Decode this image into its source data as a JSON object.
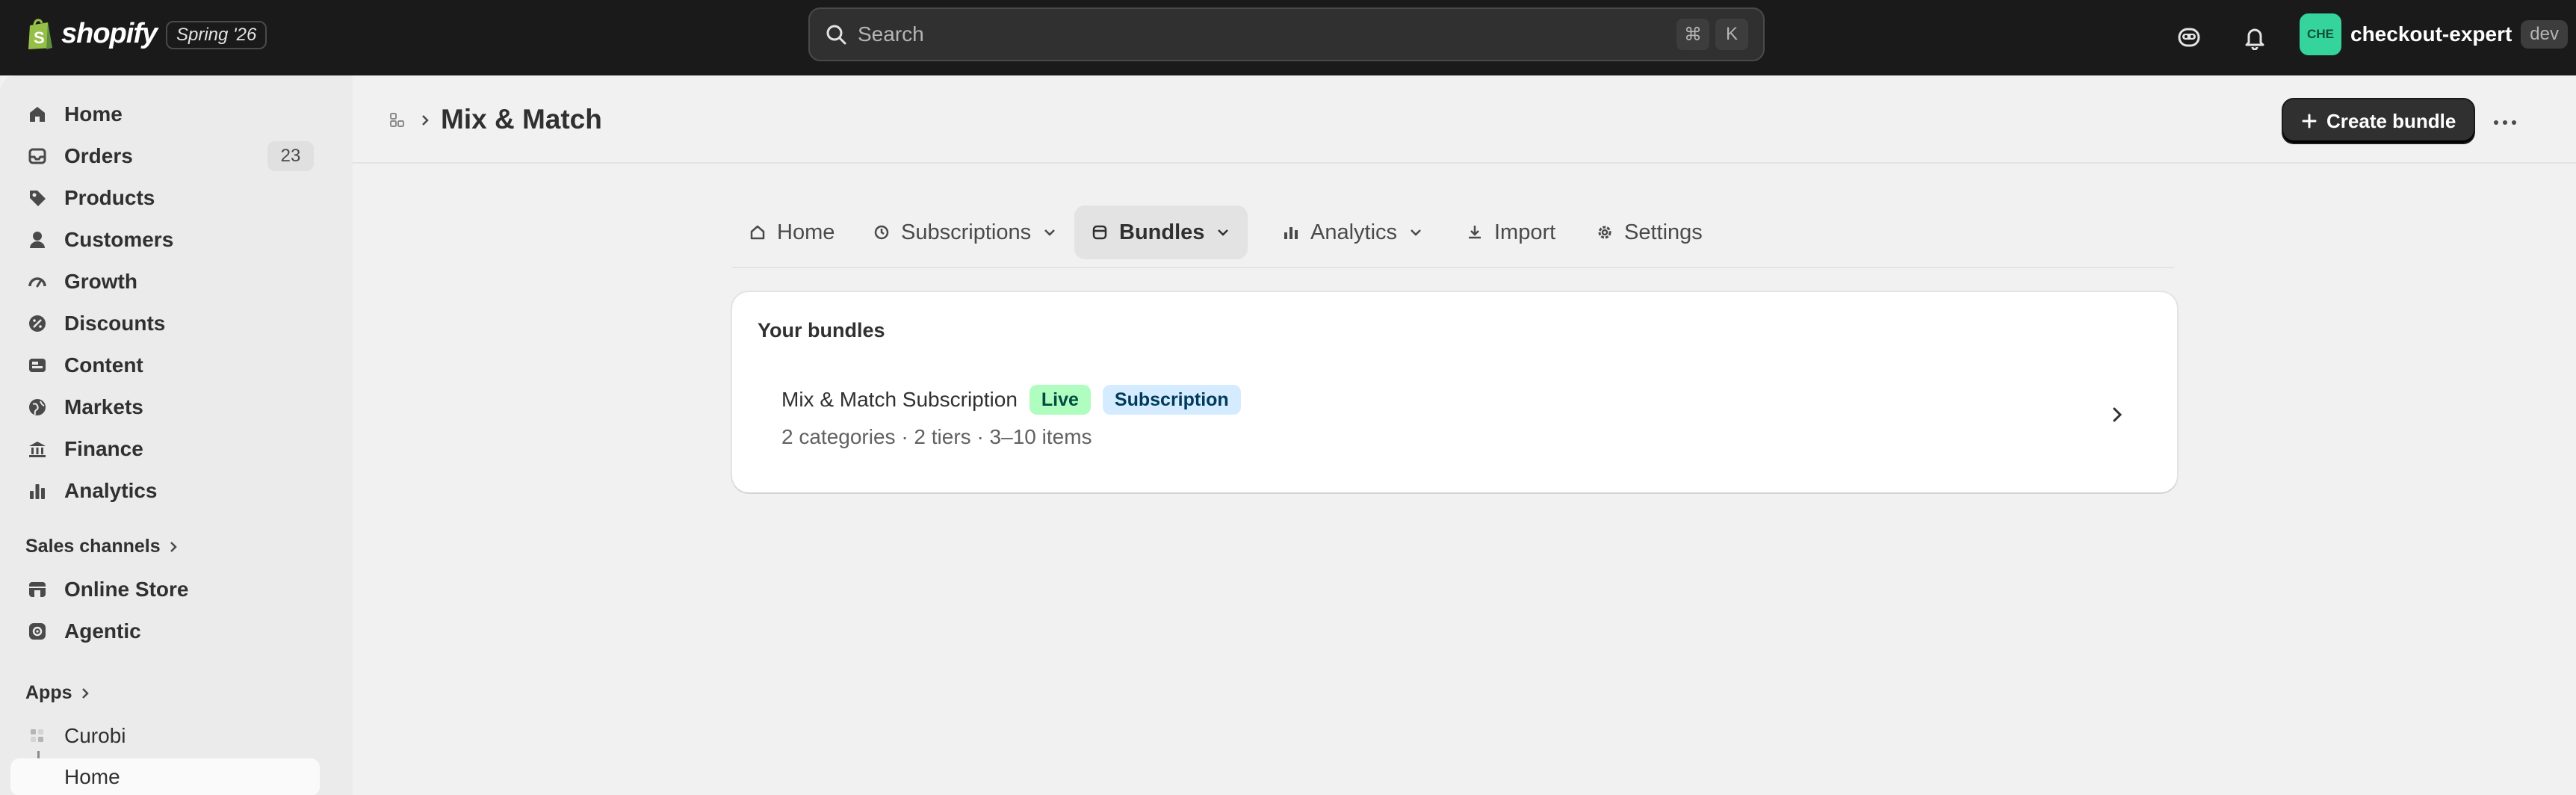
{
  "topbar": {
    "logo_text": "shopify",
    "version": "Spring '26",
    "search_placeholder": "Search",
    "shortcut_keys": [
      "⌘",
      "K"
    ],
    "account_initials": "CHE",
    "account_name": "checkout-expert",
    "account_badge": "dev"
  },
  "sidebar": {
    "items": [
      {
        "label": "Home",
        "icon": "home-icon"
      },
      {
        "label": "Orders",
        "icon": "inbox-icon",
        "count": "23"
      },
      {
        "label": "Products",
        "icon": "tag-icon"
      },
      {
        "label": "Customers",
        "icon": "person-icon"
      },
      {
        "label": "Growth",
        "icon": "gauge-icon"
      },
      {
        "label": "Discounts",
        "icon": "discount-icon"
      },
      {
        "label": "Content",
        "icon": "content-icon"
      },
      {
        "label": "Markets",
        "icon": "globe-icon"
      },
      {
        "label": "Finance",
        "icon": "bank-icon"
      },
      {
        "label": "Analytics",
        "icon": "bar-chart-icon"
      }
    ],
    "sales_channels_heading": "Sales channels",
    "sales_channels": [
      {
        "label": "Online Store",
        "icon": "store-icon"
      },
      {
        "label": "Agentic",
        "icon": "agentic-icon"
      }
    ],
    "apps_heading": "Apps",
    "apps": [
      {
        "label": "Curobi",
        "icon": "app-grid-icon"
      },
      {
        "label": "Home"
      }
    ]
  },
  "page": {
    "title": "Mix & Match",
    "create_button": "Create bundle"
  },
  "tabs": [
    {
      "label": "Home",
      "icon": "home-icon"
    },
    {
      "label": "Subscriptions",
      "icon": "subscription-icon"
    },
    {
      "label": "Bundles",
      "icon": "bundle-icon"
    },
    {
      "label": "Analytics",
      "icon": "bar-chart-icon"
    },
    {
      "label": "Import",
      "icon": "download-icon"
    },
    {
      "label": "Settings",
      "icon": "gear-icon"
    }
  ],
  "bundles_card": {
    "title": "Your bundles",
    "rows": [
      {
        "name": "Mix & Match Subscription",
        "status": "Live",
        "type": "Subscription",
        "meta": "2 categories · 2 tiers · 3–10 items"
      }
    ]
  },
  "colors": {
    "topbar_bg": "#1a1a1a",
    "sidebar_bg": "#ebebeb",
    "main_bg": "#f1f1f1",
    "primary_button": "#303030",
    "live_badge": "#affebf",
    "subscription_badge": "#d5ebff",
    "avatar": "#35d49c"
  }
}
